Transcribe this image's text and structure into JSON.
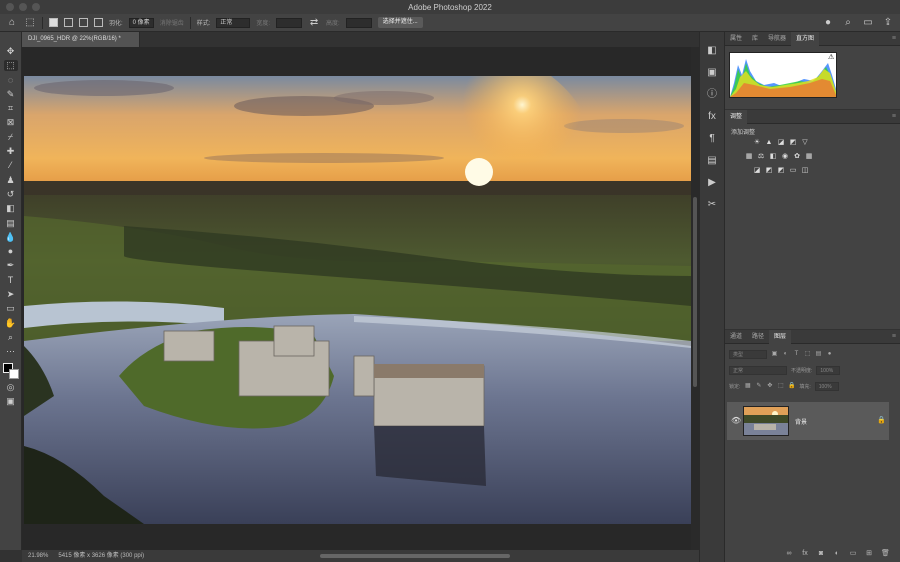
{
  "app": {
    "title": "Adobe Photoshop 2022"
  },
  "options_bar": {
    "feather_label": "羽化:",
    "feather_value": "0 像素",
    "antialias_label": "消除锯齿",
    "style_label": "样式:",
    "style_value": "正常",
    "width_label": "宽度:",
    "height_label": "高度:",
    "select_mask_button": "选择并遮住..."
  },
  "document": {
    "tab_label": "DJI_0965_HDR @ 22%(RGB/16) *",
    "zoom": "21.98%",
    "dimensions": "5415 像素 x 3626 像素 (300 ppi)"
  },
  "panels": {
    "top_tabs": [
      "属性",
      "库",
      "导航器",
      "直方图"
    ],
    "top_active": 3,
    "adjustments": {
      "tab": "调整",
      "add_label": "添加调整"
    },
    "layers_tabs": [
      "通道",
      "路径",
      "图层"
    ],
    "layers_active": 2,
    "layers": {
      "filter_kind": "类型",
      "blend_mode": "正常",
      "opacity_label": "不透明度:",
      "opacity_value": "100%",
      "lock_label": "锁定:",
      "fill_label": "填充:",
      "fill_value": "100%",
      "rows": [
        {
          "name": "背景"
        }
      ]
    }
  },
  "colors": {
    "accent": "#31a8ff",
    "bg": "#323232",
    "panel": "#434343"
  }
}
